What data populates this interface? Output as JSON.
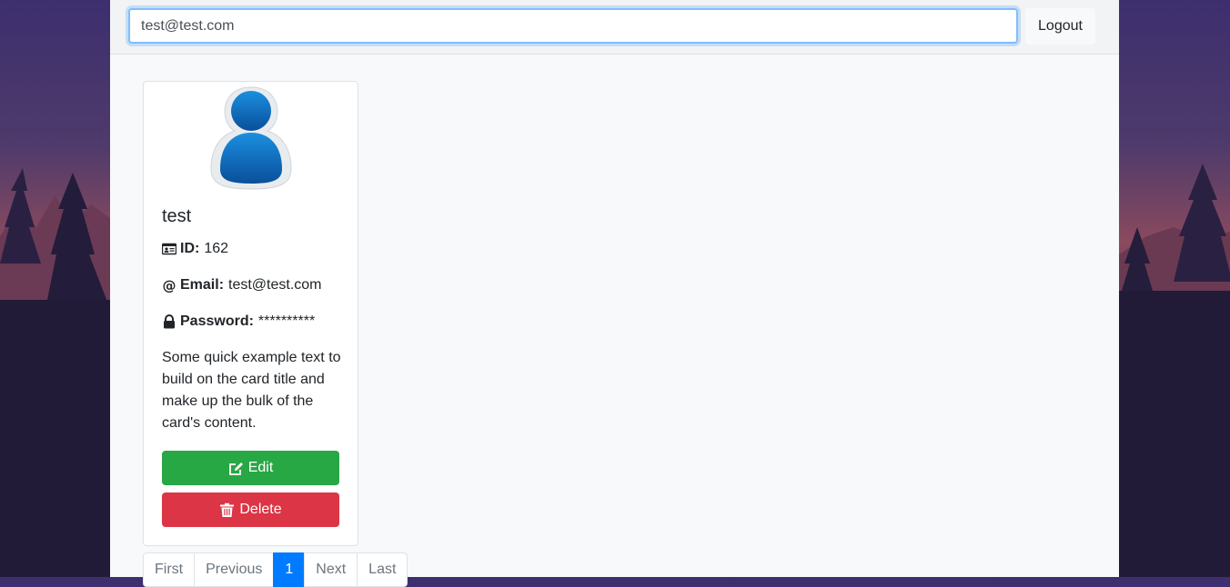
{
  "navbar": {
    "search_value": "test@test.com",
    "logout_label": "Logout"
  },
  "card": {
    "title": "test",
    "id_label": "ID:",
    "id_value": "162",
    "email_label": "Email:",
    "email_value": "test@test.com",
    "password_label": "Password:",
    "password_value": "**********",
    "text": "Some quick example text to build on the card title and make up the bulk of the card's content.",
    "edit_label": "Edit",
    "delete_label": "Delete"
  },
  "pagination": {
    "first": "First",
    "previous": "Previous",
    "current": "1",
    "next": "Next",
    "last": "Last"
  },
  "colors": {
    "edit": "#28a745",
    "delete": "#dc3545",
    "active_page": "#007bff",
    "avatar": "#0a66b8"
  },
  "icons": [
    "id-card-icon",
    "at-icon",
    "lock-icon",
    "edit-icon",
    "trash-icon",
    "user-avatar-icon"
  ]
}
